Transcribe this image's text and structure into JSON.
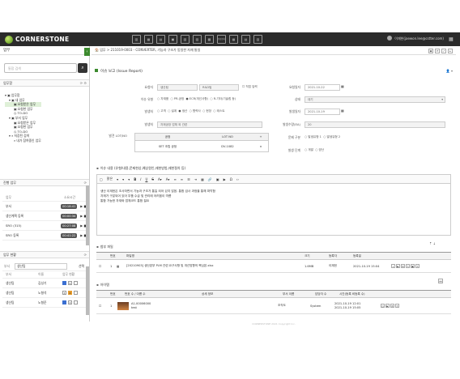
{
  "app": {
    "logo": "CORNERSTONE",
    "user": "이재헌(jaewon.lee@cstter.com)"
  },
  "topicons": [
    "▥",
    "▦",
    "▤",
    "▣",
    "▧",
    "▨",
    "▩",
    "변경관리",
    "▦",
    "▤",
    "▥"
  ],
  "left": {
    "header": "업무",
    "search_placeholder": "통합 검색",
    "sec_work": "업무함",
    "tree": [
      "업무함",
      "내 업무",
      "요청받은 업무",
      "요청한 업무",
      "TO-DO",
      "부서 업무",
      "요청받은 업무",
      "요청한 업무",
      "TO-DO",
      "저장된 검색",
      "내가 참여중인 업무"
    ],
    "sec_running": "진행 업무",
    "running_head": [
      "업무",
      "소요시간"
    ],
    "running": [
      {
        "name": "부서",
        "time": "00:18:41"
      },
      {
        "name": "생산계획 등록",
        "time": "00:00:34"
      },
      {
        "name": "SRO (315)",
        "time": "00:27:08"
      },
      {
        "name": "SRO 등록",
        "time": "00:41:22"
      }
    ],
    "sec_status": "업무 현황",
    "status_filter": "생산팀",
    "status_btn": "선택",
    "status_head": [
      "부서",
      "이름",
      "업무 현황"
    ],
    "status_rows": [
      {
        "dept": "생산팀",
        "name": "김성기",
        "a": "5",
        "b": ""
      },
      {
        "dept": "생산팀",
        "name": "노형석",
        "a": "3",
        "b": "4"
      },
      {
        "dept": "생산팀",
        "name": "노형준",
        "a": "3",
        "b": ""
      }
    ]
  },
  "main": {
    "breadcrumb": "🏠 업무 > 211019-0003 - CONVERTER, 기능과 구조가 동일한 자재 통일",
    "title": "이슈 보고 (Issue Report)",
    "fields": {
      "requester_label": "요청자",
      "requester": "생산팀",
      "requester2": "R&D팀",
      "direct_input": "직접 입력",
      "req_date_label": "요청일자",
      "req_date": "2021-10-22",
      "issue_type_label": "이슈 유형",
      "issue_types": [
        "자재품",
        "PR-공정",
        "ECR(개선사항)",
        "R-기타(기술힙 등)"
      ],
      "status_label": "상태",
      "status": "대기",
      "occur_label": "발생처",
      "occurs": [
        "고객",
        "설계",
        "생산",
        "협력사",
        "현장",
        "테스트"
      ],
      "occur_date_label": "발생일자",
      "occur_date": "2021-10-19",
      "occur_place_label": "발생처",
      "occur_place": "자재공장 업체 외 관련",
      "occur_qty_label": "발생수량(EA)",
      "occur_qty": "20",
      "lot_label": "발견 LOT/NO",
      "lot_head": [
        "공정",
        "LOT NO"
      ],
      "lot_row": [
        "SET 조립 공정",
        "DV-1082"
      ],
      "class_label": "문제 구분",
      "classes": [
        "발생유형 1",
        "발생유형 2"
      ],
      "stage_label": "발생 단계",
      "stages": [
        "개발",
        "양산"
      ]
    },
    "content_label": "이슈 내용 (유형/내용,문제현상,예상원인,재현방법,재현절차 등)",
    "editor_font": "맑은",
    "editor_lines": [
      "생산 이재헌은 조사하면서 기능과 구조가 통일 되어 있지 않음. 통합 검사 과정을 통해 파악함",
      "자재가 구분되어 있어 부품 수급 및 관리에 어려움이 따름",
      "통합 가능한 자재와 업체코드 통합 필요"
    ],
    "attach_label": "첨부 파일",
    "attach_head": [
      "번호",
      "파일명",
      "크기",
      "등록자",
      "등록일"
    ],
    "attach_rows": [
      {
        "no": "1",
        "name": "[20210903] 생산본부 PLM 관련 요구사항 및 개선방향의 핵심본.xlsx",
        "size": "1.6MB",
        "user": "이재헌",
        "date": "2021-10-19 15:04"
      }
    ],
    "items_label": "아이템",
    "items_head": [
      "번호",
      "번호 수 / 이름 수",
      "상세 정보",
      "부서 이름",
      "담당자 수",
      "시간(등록 비등록 수)"
    ],
    "items_rows": [
      {
        "no": "1",
        "id": "A1-00006000",
        "name": "test",
        "dept": "조직도",
        "owner": "System",
        "time1": "2021-10-19 12:01",
        "time2": "2021-10-19 15:05"
      }
    ],
    "footer": "CORNERSTONE 2021 Copyright Inc."
  }
}
